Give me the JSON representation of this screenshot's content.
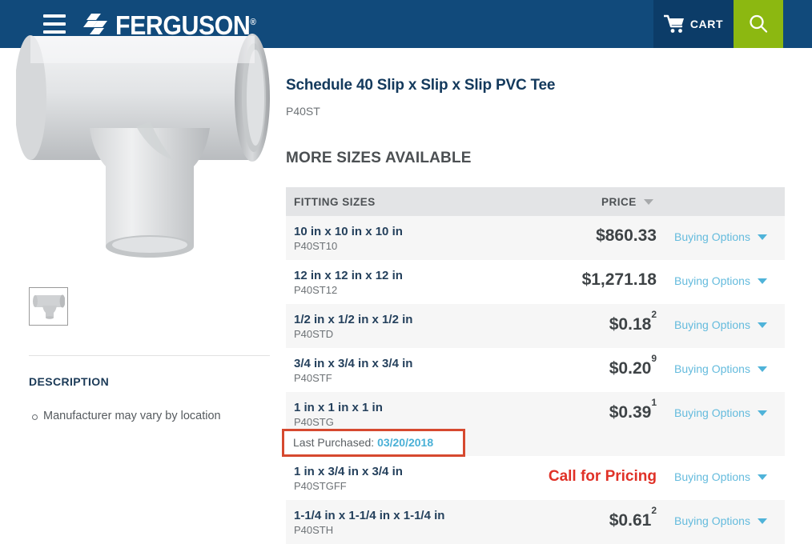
{
  "header": {
    "menu_icon": "hamburger-menu-icon",
    "logo_text": "FERGUSON",
    "logo_registered": "®",
    "cart_label": "CART",
    "cart_icon": "shopping-cart-icon",
    "search_icon": "search-icon",
    "colors": {
      "navy": "#114a7b",
      "cart_navy": "#0c3c68",
      "green": "#8cb811"
    }
  },
  "product": {
    "title": "Schedule 40 Slip x Slip x Slip PVC Tee",
    "sku": "P40ST",
    "image_alt": "pvc-tee-fitting",
    "thumbnail_alt": "pvc-tee-thumbnail"
  },
  "description": {
    "heading": "DESCRIPTION",
    "items": [
      "Manufacturer may vary by location"
    ]
  },
  "sizes_section": {
    "heading": "MORE SIZES AVAILABLE",
    "columns": {
      "sizes": "FITTING SIZES",
      "price": "PRICE"
    },
    "sort_indicator": "sort-descending-caret",
    "rows": [
      {
        "size": "10 in x 10 in x 10 in",
        "sku": "P40ST10",
        "price": "$860.33",
        "price_sup": "",
        "options_label": "Buying Options"
      },
      {
        "size": "12 in x 12 in x 12 in",
        "sku": "P40ST12",
        "price": "$1,271.18",
        "price_sup": "",
        "options_label": "Buying Options"
      },
      {
        "size": "1/2 in x 1/2 in x 1/2 in",
        "sku": "P40STD",
        "price": "$0.18",
        "price_sup": "2",
        "options_label": "Buying Options"
      },
      {
        "size": "3/4 in x 3/4 in x 3/4 in",
        "sku": "P40STF",
        "price": "$0.20",
        "price_sup": "9",
        "options_label": "Buying Options"
      },
      {
        "size": "1 in x 1 in x 1 in",
        "sku": "P40STG",
        "price": "$0.39",
        "price_sup": "1",
        "options_label": "Buying Options",
        "last_purchased_label": "Last Purchased:",
        "last_purchased_date": "03/20/2018"
      },
      {
        "size": "1 in x 3/4 in x 3/4 in",
        "sku": "P40STGFF",
        "price": "Call for Pricing",
        "price_sup": "",
        "options_label": "Buying Options"
      },
      {
        "size": "1-1/4 in x 1-1/4 in x 1-1/4 in",
        "sku": "P40STH",
        "price": "$0.61",
        "price_sup": "2",
        "options_label": "Buying Options"
      }
    ]
  },
  "annotation": {
    "label": "Last Purchased:",
    "date": "03/20/2018",
    "border_color": "#d6492f"
  }
}
